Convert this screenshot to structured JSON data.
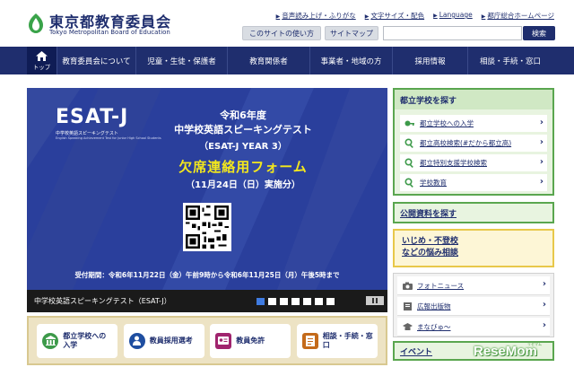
{
  "header": {
    "title": "東京都教育委員会",
    "subtitle": "Tokyo Metropolitan Board of Education",
    "links": [
      "音声読み上げ・ふりがな",
      "文字サイズ・配色",
      "Language",
      "都庁総合ホームページ"
    ],
    "guide_label": "このサイトの使い方",
    "sitemap_label": "サイトマップ",
    "search_placeholder": "",
    "search_label": "検索"
  },
  "nav": {
    "home_label": "トップ",
    "items": [
      "教育委員会について",
      "児童・生徒・保護者",
      "教育関係者",
      "事業者・地域の方",
      "採用情報",
      "相談・手続・窓口"
    ]
  },
  "banner": {
    "logo": "ESAT-J",
    "logo_sub": "中学校英語スピーキングテスト",
    "logo_sub2": "English Speaking Achievement Test for Junior High School Students",
    "year": "令和6年度",
    "test_name": "中学校英語スピーキングテスト",
    "test_code": "（ESAT-J YEAR 3）",
    "form": "欠席連絡用フォーム",
    "exam_date": "（11月24日（日）実施分）",
    "period": "受付期間：令和6年11月22日（金）午前9時から令和6年11月25日（月）午後5時まで",
    "caption": "中学校英語スピーキングテスト（ESAT-J）",
    "active_slide": 1,
    "slide_count": 8
  },
  "quick": [
    {
      "line1": "都立学校への",
      "line2": "入学",
      "icon": "school-icon",
      "color": "#3d9a4a"
    },
    {
      "line1": "教員採用選考",
      "line2": "",
      "icon": "person-icon",
      "color": "#1f4ea0"
    },
    {
      "line1": "教員免許",
      "line2": "",
      "icon": "license-icon",
      "color": "#a0246e"
    },
    {
      "line1": "相談・手続・窓口",
      "line2": "",
      "icon": "document-icon",
      "color": "#c46a1a"
    }
  ],
  "school": {
    "title": "都立学校を探す",
    "items": [
      "都立学校への入学",
      "都立高校検索(#だから都立高)",
      "都立特別支援学校検索",
      "学校教育"
    ]
  },
  "public_label": "公開資料を探す",
  "bully": {
    "line1": "いじめ・不登校",
    "line2": "などの悩み相談"
  },
  "links": [
    "フォトニュース",
    "広報出版物",
    "まなびゅ〜"
  ],
  "event_label": "イベント",
  "watermark": {
    "brand": "ReseMom",
    "small": "リセマム"
  },
  "colors": {
    "navy": "#1f2e6e",
    "green": "#5aa64f",
    "banner": "#2a3f9c",
    "yellow": "#f3e71d"
  }
}
